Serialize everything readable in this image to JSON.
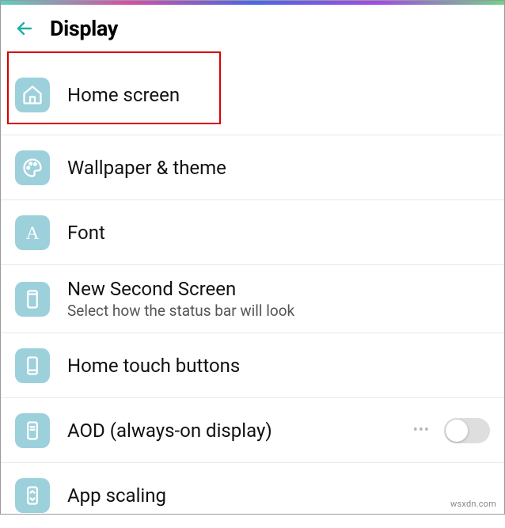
{
  "header": {
    "title": "Display"
  },
  "items": [
    {
      "label": "Home screen"
    },
    {
      "label": "Wallpaper & theme"
    },
    {
      "label": "Font"
    },
    {
      "label": "New Second Screen",
      "sub": "Select how the status bar will look"
    },
    {
      "label": "Home touch buttons"
    },
    {
      "label": "AOD (always-on display)",
      "toggle": false
    },
    {
      "label": "App scaling"
    }
  ],
  "watermark": "wsxdn.com"
}
